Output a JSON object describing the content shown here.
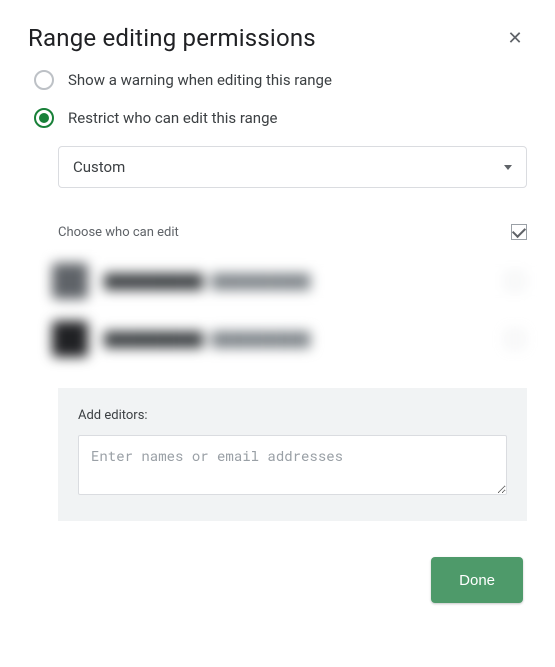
{
  "dialog": {
    "title": "Range editing permissions"
  },
  "options": {
    "warning_label": "Show a warning when editing this range",
    "restrict_label": "Restrict who can edit this range",
    "selected": "restrict"
  },
  "dropdown": {
    "selected_label": "Custom"
  },
  "choose": {
    "label": "Choose who can edit"
  },
  "users": [
    {
      "name": "██████████",
      "email": "██████████"
    },
    {
      "name": "██████████",
      "email": "██████████"
    }
  ],
  "add": {
    "label": "Add editors:",
    "placeholder": "Enter names or email addresses"
  },
  "footer": {
    "done_label": "Done"
  }
}
